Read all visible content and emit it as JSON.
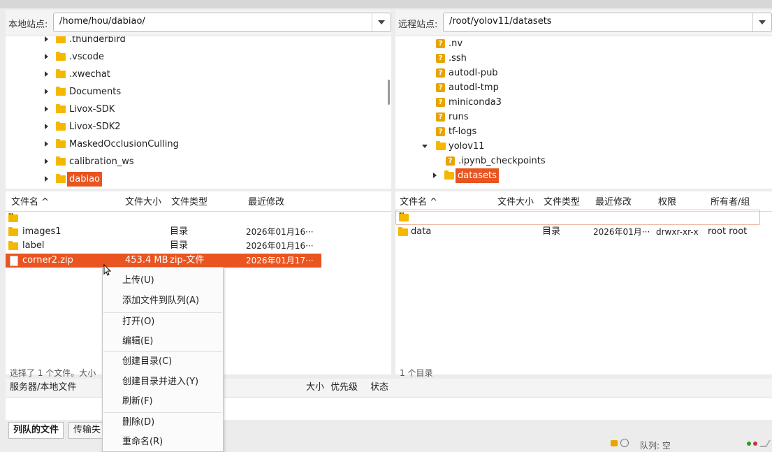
{
  "local": {
    "site_label": "本地站点:",
    "path": "/home/hou/dabiao/",
    "tree": [
      {
        "name": ".thunderbird"
      },
      {
        "name": ".vscode"
      },
      {
        "name": ".xwechat"
      },
      {
        "name": "Documents"
      },
      {
        "name": "Livox-SDK"
      },
      {
        "name": "Livox-SDK2"
      },
      {
        "name": "MaskedOcclusionCulling"
      },
      {
        "name": "calibration_ws"
      },
      {
        "name": "dabiao"
      }
    ],
    "columns": {
      "name": "文件名 ^",
      "size": "文件大小",
      "type": "文件类型",
      "modified": "最近修改"
    },
    "files": [
      {
        "name": "..",
        "size": "",
        "type": "",
        "modified": ""
      },
      {
        "name": "images1",
        "size": "",
        "type": "目录",
        "modified": "2026年01月16···"
      },
      {
        "name": "label",
        "size": "",
        "type": "目录",
        "modified": "2026年01月16···"
      },
      {
        "name": "corner2.zip",
        "size": "453.4 MB",
        "type": "zip-文件",
        "modified": "2026年01月17···"
      }
    ],
    "status": "选择了 1 个文件。大小"
  },
  "remote": {
    "site_label": "远程站点:",
    "path": "/root/yolov11/datasets",
    "tree": [
      {
        "name": ".nv"
      },
      {
        "name": ".ssh"
      },
      {
        "name": "autodl-pub"
      },
      {
        "name": "autodl-tmp"
      },
      {
        "name": "miniconda3"
      },
      {
        "name": "runs"
      },
      {
        "name": "tf-logs"
      },
      {
        "name": "yolov11"
      },
      {
        "name": ".ipynb_checkpoints"
      },
      {
        "name": "datasets"
      }
    ],
    "columns": {
      "name": "文件名 ^",
      "size": "文件大小",
      "type": "文件类型",
      "modified": "最近修改",
      "perms": "权限",
      "owner": "所有者/组"
    },
    "files": [
      {
        "name": "..",
        "size": "",
        "type": "",
        "modified": "",
        "perms": "",
        "owner": ""
      },
      {
        "name": "data",
        "size": "",
        "type": "目录",
        "modified": "2026年01月···",
        "perms": "drwxr-xr-x",
        "owner": "root root"
      }
    ],
    "status": "1 个目录"
  },
  "queue": {
    "col_server": "服务器/本地文件",
    "col_size": "大小",
    "col_priority": "优先级",
    "col_status": "状态",
    "tab_queued": "列队的文件",
    "tab_failed": "传输失",
    "queue_status": "队列: 空"
  },
  "context_menu": {
    "upload": "上传(U)",
    "add_to_queue": "添加文件到队列(A)",
    "open": "打开(O)",
    "edit": "编辑(E)",
    "mkdir": "创建目录(C)",
    "mkdir_enter": "创建目录并进入(Y)",
    "refresh": "刷新(F)",
    "delete": "删除(D)",
    "rename": "重命名(R)"
  },
  "colors": {
    "accent": "#e95420",
    "folder": "#f5b800"
  }
}
